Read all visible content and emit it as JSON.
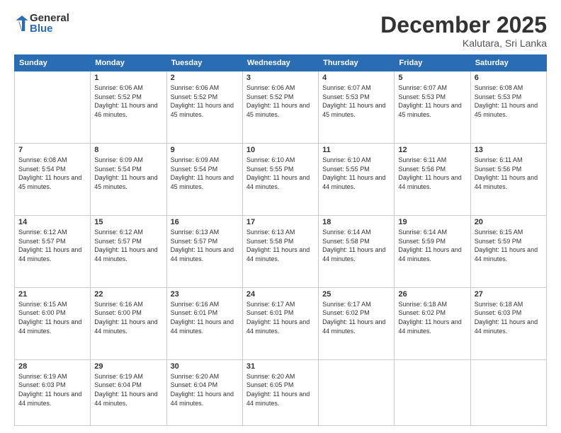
{
  "logo": {
    "general": "General",
    "blue": "Blue"
  },
  "title": {
    "month": "December 2025",
    "location": "Kalutara, Sri Lanka"
  },
  "weekdays": [
    "Sunday",
    "Monday",
    "Tuesday",
    "Wednesday",
    "Thursday",
    "Friday",
    "Saturday"
  ],
  "weeks": [
    [
      {
        "day": "",
        "sunrise": "",
        "sunset": "",
        "daylight": ""
      },
      {
        "day": "1",
        "sunrise": "Sunrise: 6:06 AM",
        "sunset": "Sunset: 5:52 PM",
        "daylight": "Daylight: 11 hours and 46 minutes."
      },
      {
        "day": "2",
        "sunrise": "Sunrise: 6:06 AM",
        "sunset": "Sunset: 5:52 PM",
        "daylight": "Daylight: 11 hours and 45 minutes."
      },
      {
        "day": "3",
        "sunrise": "Sunrise: 6:06 AM",
        "sunset": "Sunset: 5:52 PM",
        "daylight": "Daylight: 11 hours and 45 minutes."
      },
      {
        "day": "4",
        "sunrise": "Sunrise: 6:07 AM",
        "sunset": "Sunset: 5:53 PM",
        "daylight": "Daylight: 11 hours and 45 minutes."
      },
      {
        "day": "5",
        "sunrise": "Sunrise: 6:07 AM",
        "sunset": "Sunset: 5:53 PM",
        "daylight": "Daylight: 11 hours and 45 minutes."
      },
      {
        "day": "6",
        "sunrise": "Sunrise: 6:08 AM",
        "sunset": "Sunset: 5:53 PM",
        "daylight": "Daylight: 11 hours and 45 minutes."
      }
    ],
    [
      {
        "day": "7",
        "sunrise": "Sunrise: 6:08 AM",
        "sunset": "Sunset: 5:54 PM",
        "daylight": "Daylight: 11 hours and 45 minutes."
      },
      {
        "day": "8",
        "sunrise": "Sunrise: 6:09 AM",
        "sunset": "Sunset: 5:54 PM",
        "daylight": "Daylight: 11 hours and 45 minutes."
      },
      {
        "day": "9",
        "sunrise": "Sunrise: 6:09 AM",
        "sunset": "Sunset: 5:54 PM",
        "daylight": "Daylight: 11 hours and 45 minutes."
      },
      {
        "day": "10",
        "sunrise": "Sunrise: 6:10 AM",
        "sunset": "Sunset: 5:55 PM",
        "daylight": "Daylight: 11 hours and 44 minutes."
      },
      {
        "day": "11",
        "sunrise": "Sunrise: 6:10 AM",
        "sunset": "Sunset: 5:55 PM",
        "daylight": "Daylight: 11 hours and 44 minutes."
      },
      {
        "day": "12",
        "sunrise": "Sunrise: 6:11 AM",
        "sunset": "Sunset: 5:56 PM",
        "daylight": "Daylight: 11 hours and 44 minutes."
      },
      {
        "day": "13",
        "sunrise": "Sunrise: 6:11 AM",
        "sunset": "Sunset: 5:56 PM",
        "daylight": "Daylight: 11 hours and 44 minutes."
      }
    ],
    [
      {
        "day": "14",
        "sunrise": "Sunrise: 6:12 AM",
        "sunset": "Sunset: 5:57 PM",
        "daylight": "Daylight: 11 hours and 44 minutes."
      },
      {
        "day": "15",
        "sunrise": "Sunrise: 6:12 AM",
        "sunset": "Sunset: 5:57 PM",
        "daylight": "Daylight: 11 hours and 44 minutes."
      },
      {
        "day": "16",
        "sunrise": "Sunrise: 6:13 AM",
        "sunset": "Sunset: 5:57 PM",
        "daylight": "Daylight: 11 hours and 44 minutes."
      },
      {
        "day": "17",
        "sunrise": "Sunrise: 6:13 AM",
        "sunset": "Sunset: 5:58 PM",
        "daylight": "Daylight: 11 hours and 44 minutes."
      },
      {
        "day": "18",
        "sunrise": "Sunrise: 6:14 AM",
        "sunset": "Sunset: 5:58 PM",
        "daylight": "Daylight: 11 hours and 44 minutes."
      },
      {
        "day": "19",
        "sunrise": "Sunrise: 6:14 AM",
        "sunset": "Sunset: 5:59 PM",
        "daylight": "Daylight: 11 hours and 44 minutes."
      },
      {
        "day": "20",
        "sunrise": "Sunrise: 6:15 AM",
        "sunset": "Sunset: 5:59 PM",
        "daylight": "Daylight: 11 hours and 44 minutes."
      }
    ],
    [
      {
        "day": "21",
        "sunrise": "Sunrise: 6:15 AM",
        "sunset": "Sunset: 6:00 PM",
        "daylight": "Daylight: 11 hours and 44 minutes."
      },
      {
        "day": "22",
        "sunrise": "Sunrise: 6:16 AM",
        "sunset": "Sunset: 6:00 PM",
        "daylight": "Daylight: 11 hours and 44 minutes."
      },
      {
        "day": "23",
        "sunrise": "Sunrise: 6:16 AM",
        "sunset": "Sunset: 6:01 PM",
        "daylight": "Daylight: 11 hours and 44 minutes."
      },
      {
        "day": "24",
        "sunrise": "Sunrise: 6:17 AM",
        "sunset": "Sunset: 6:01 PM",
        "daylight": "Daylight: 11 hours and 44 minutes."
      },
      {
        "day": "25",
        "sunrise": "Sunrise: 6:17 AM",
        "sunset": "Sunset: 6:02 PM",
        "daylight": "Daylight: 11 hours and 44 minutes."
      },
      {
        "day": "26",
        "sunrise": "Sunrise: 6:18 AM",
        "sunset": "Sunset: 6:02 PM",
        "daylight": "Daylight: 11 hours and 44 minutes."
      },
      {
        "day": "27",
        "sunrise": "Sunrise: 6:18 AM",
        "sunset": "Sunset: 6:03 PM",
        "daylight": "Daylight: 11 hours and 44 minutes."
      }
    ],
    [
      {
        "day": "28",
        "sunrise": "Sunrise: 6:19 AM",
        "sunset": "Sunset: 6:03 PM",
        "daylight": "Daylight: 11 hours and 44 minutes."
      },
      {
        "day": "29",
        "sunrise": "Sunrise: 6:19 AM",
        "sunset": "Sunset: 6:04 PM",
        "daylight": "Daylight: 11 hours and 44 minutes."
      },
      {
        "day": "30",
        "sunrise": "Sunrise: 6:20 AM",
        "sunset": "Sunset: 6:04 PM",
        "daylight": "Daylight: 11 hours and 44 minutes."
      },
      {
        "day": "31",
        "sunrise": "Sunrise: 6:20 AM",
        "sunset": "Sunset: 6:05 PM",
        "daylight": "Daylight: 11 hours and 44 minutes."
      },
      {
        "day": "",
        "sunrise": "",
        "sunset": "",
        "daylight": ""
      },
      {
        "day": "",
        "sunrise": "",
        "sunset": "",
        "daylight": ""
      },
      {
        "day": "",
        "sunrise": "",
        "sunset": "",
        "daylight": ""
      }
    ]
  ]
}
